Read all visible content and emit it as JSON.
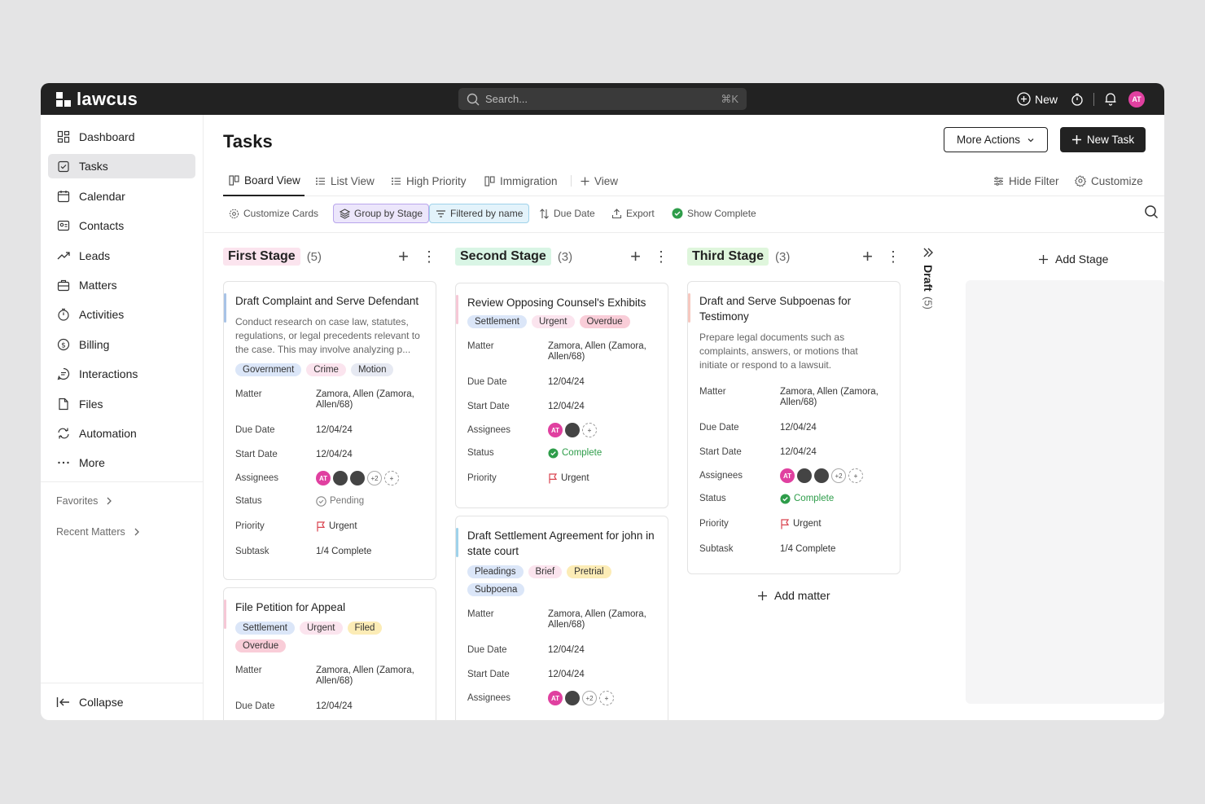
{
  "app": {
    "name": "lawcus"
  },
  "topbar": {
    "search_placeholder": "Search...",
    "shortcut": "⌘K",
    "new_label": "New",
    "avatar_initials": "AT"
  },
  "sidebar": {
    "items": [
      {
        "label": "Dashboard",
        "icon": "dashboard-icon"
      },
      {
        "label": "Tasks",
        "icon": "tasks-icon",
        "active": true
      },
      {
        "label": "Calendar",
        "icon": "calendar-icon"
      },
      {
        "label": "Contacts",
        "icon": "contacts-icon"
      },
      {
        "label": "Leads",
        "icon": "leads-icon"
      },
      {
        "label": "Matters",
        "icon": "matters-icon"
      },
      {
        "label": "Activities",
        "icon": "activities-icon"
      },
      {
        "label": "Billing",
        "icon": "billing-icon"
      },
      {
        "label": "Interactions",
        "icon": "interactions-icon"
      },
      {
        "label": "Files",
        "icon": "files-icon"
      },
      {
        "label": "Automation",
        "icon": "automation-icon"
      },
      {
        "label": "More",
        "icon": "more-icon"
      }
    ],
    "favorites": "Favorites",
    "recent_matters": "Recent Matters",
    "collapse": "Collapse"
  },
  "page": {
    "title": "Tasks",
    "more_actions": "More Actions",
    "new_task": "New Task"
  },
  "tabs": [
    {
      "label": "Board View",
      "active": true
    },
    {
      "label": "List View"
    },
    {
      "label": "High Priority"
    },
    {
      "label": "Immigration"
    },
    {
      "label": "View"
    }
  ],
  "tabs_right": {
    "hide_filter": "Hide Filter",
    "customize": "Customize"
  },
  "toolbar": {
    "customize_cards": "Customize Cards",
    "group_by_stage": "Group by Stage",
    "filtered_by_name": "Filtered by name",
    "due_date": "Due Date",
    "export": "Export",
    "show_complete": "Show Complete"
  },
  "labels": {
    "matter": "Matter",
    "due_date": "Due Date",
    "start_date": "Start Date",
    "assignees": "Assignees",
    "status": "Status",
    "priority": "Priority",
    "subtask": "Subtask"
  },
  "columns": [
    {
      "name": "First Stage",
      "count": "(5)",
      "color": "#fbe4ee"
    },
    {
      "name": "Second Stage",
      "count": "(3)",
      "color": "#d9f5e5"
    },
    {
      "name": "Third Stage",
      "count": "(3)",
      "color": "#dff6dc"
    }
  ],
  "draft": {
    "label": "Draft",
    "count": "(5)"
  },
  "add_stage": "Add Stage",
  "add_matter": "Add matter",
  "cards": {
    "c1": {
      "title": "Draft Complaint and Serve Defendant",
      "desc": "Conduct research on case law, statutes, regulations, or legal precedents relevant to the case. This may involve analyzing p...",
      "tags": [
        "Government",
        "Crime",
        "Motion"
      ],
      "matter": "Zamora, Allen (Zamora, Allen/68)",
      "due": "12/04/24",
      "start": "12/04/24",
      "plus": "+2",
      "status": "Pending",
      "priority": "Urgent",
      "subtask": "1/4 Complete"
    },
    "c2": {
      "title": "File Petition for Appeal",
      "tags": [
        "Settlement",
        "Urgent",
        "Filed",
        "Overdue"
      ],
      "matter": "Zamora, Allen (Zamora, Allen/68)",
      "due": "12/04/24"
    },
    "c3": {
      "title": "Review Opposing Counsel's Exhibits",
      "tags": [
        "Settlement",
        "Urgent",
        "Overdue"
      ],
      "matter": "Zamora, Allen (Zamora, Allen/68)",
      "due": "12/04/24",
      "start": "12/04/24",
      "status": "Complete",
      "priority": "Urgent"
    },
    "c4": {
      "title": "Draft Settlement Agreement for john in state court",
      "tags": [
        "Pleadings",
        "Brief",
        "Pretrial",
        "Subpoena"
      ],
      "matter": "Zamora, Allen (Zamora, Allen/68)",
      "due": "12/04/24",
      "start": "12/04/24",
      "plus": "+2"
    },
    "c5": {
      "title": "Draft and Serve Subpoenas for Testimony",
      "desc": "Prepare legal documents such as complaints, answers, or motions that initiate or respond to a lawsuit.",
      "matter": "Zamora, Allen (Zamora, Allen/68)",
      "due": "12/04/24",
      "start": "12/04/24",
      "plus": "+2",
      "status": "Complete",
      "priority": "Urgent",
      "subtask": "1/4 Complete"
    }
  },
  "colors": {
    "topbar": "#222222",
    "accent_pink": "#e040a0",
    "complete_green": "#2e9d4a",
    "urgent_red": "#d9434f"
  }
}
